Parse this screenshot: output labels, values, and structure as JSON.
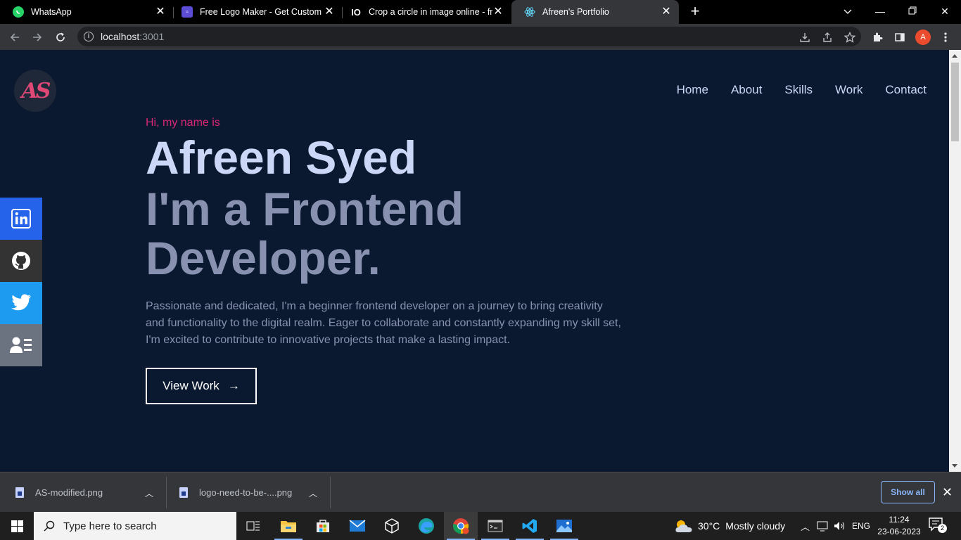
{
  "browser": {
    "tabs": [
      {
        "title": "WhatsApp",
        "icon": "whatsapp-icon",
        "color": "#25d366"
      },
      {
        "title": "Free Logo Maker - Get Custom Lo",
        "icon": "logo-maker-icon",
        "color": "#5b4dd6"
      },
      {
        "title": "Crop a circle in image online - fre",
        "icon": "io-icon",
        "color": "#ffffff"
      },
      {
        "title": "Afreen's Portfolio",
        "icon": "react-icon",
        "color": "#61dafb"
      }
    ],
    "url_host": "localhost",
    "url_port": ":3001",
    "profile_initial": "A"
  },
  "site": {
    "logo_text": "AS",
    "nav": [
      "Home",
      "About",
      "Skills",
      "Work",
      "Contact"
    ],
    "greeting": "Hi, my name is",
    "name": "Afreen Syed",
    "role_line1": "I'm a Frontend",
    "role_line2": "Developer.",
    "description": "Passionate and dedicated, I'm a beginner frontend developer on a journey to bring creativity and functionality to the digital realm. Eager to collaborate and constantly expanding my skill set, I'm excited to contribute to innovative projects that make a lasting impact.",
    "cta_label": "View Work",
    "cta_arrow": "→",
    "colors": {
      "background": "#0a192f",
      "accent": "#db2777",
      "heading": "#ccd6f6",
      "muted": "#8892b0"
    }
  },
  "downloads": {
    "items": [
      "AS-modified.png",
      "logo-need-to-be-....png"
    ],
    "show_all": "Show all"
  },
  "taskbar": {
    "search_placeholder": "Type here to search",
    "weather_temp": "30°C",
    "weather_desc": "Mostly cloudy",
    "lang": "ENG",
    "time": "11:24",
    "date": "23-06-2023",
    "notification_count": "2"
  }
}
